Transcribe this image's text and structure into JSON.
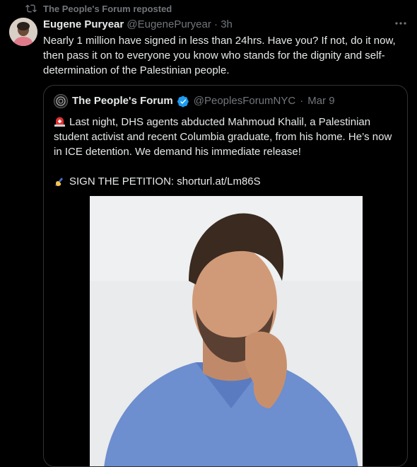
{
  "repost": {
    "label": "The People's Forum reposted",
    "icon": "repost-icon"
  },
  "tweet": {
    "author_name": "Eugene Puryear",
    "author_handle": "@EugenePuryear",
    "separator": "·",
    "time": "3h",
    "more_icon": "more-icon",
    "text": "Nearly 1 million have signed in less than 24hrs. Have you? If not, do it now, then pass it on to everyone you know who stands for the dignity and self-determination of the Palestinian people."
  },
  "quote": {
    "author_name": "The People's Forum",
    "author_handle": "@PeoplesForumNYC",
    "separator": "·",
    "date": "Mar 9",
    "verified_icon": "verified-badge-icon",
    "verified_color": "#1d9bf0",
    "line1": "Last night, DHS agents abducted Mahmoud Khalil, a Palestinian student activist and recent Columbia graduate, from his home. He’s now in ICE detention. We demand his immediate release!",
    "line1_icon": "siren-icon",
    "line2": "SIGN THE PETITION: shorturl.at/Lm86S",
    "line2_icon": "writing-hand-icon"
  },
  "colors": {
    "background": "#000000",
    "text": "#e7e9ea",
    "muted": "#71767b",
    "border": "#2f3336"
  }
}
